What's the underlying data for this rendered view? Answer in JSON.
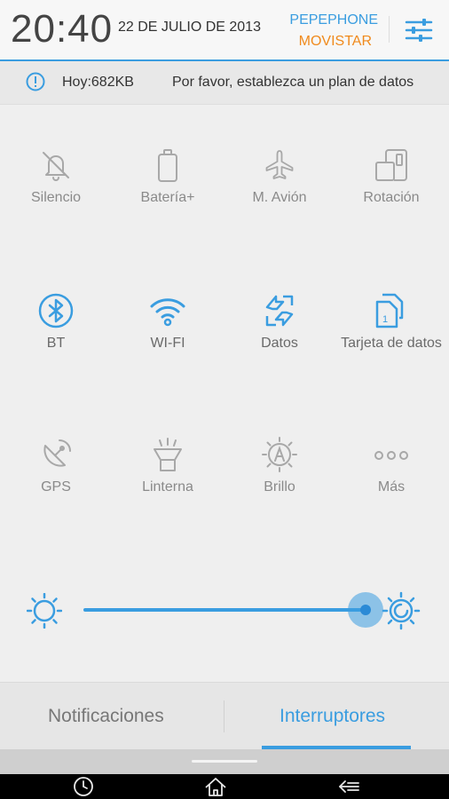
{
  "status": {
    "time": "20:40",
    "date": "22 DE JULIO DE 2013",
    "carrier_primary": "PEPEPHONE",
    "carrier_secondary": "MOVISTAR"
  },
  "data_usage": {
    "today": "Hoy:682KB",
    "message": "Por favor, establezca un plan de datos"
  },
  "toggles": [
    {
      "label": "Silencio",
      "icon": "bell-off-icon",
      "state": "off"
    },
    {
      "label": "Batería+",
      "icon": "battery-icon",
      "state": "off"
    },
    {
      "label": "M. Avión",
      "icon": "airplane-icon",
      "state": "off"
    },
    {
      "label": "Rotación",
      "icon": "rotation-icon",
      "state": "off"
    },
    {
      "label": "BT",
      "icon": "bluetooth-icon",
      "state": "on"
    },
    {
      "label": "WI-FI",
      "icon": "wifi-icon",
      "state": "on"
    },
    {
      "label": "Datos",
      "icon": "data-transfer-icon",
      "state": "on"
    },
    {
      "label": "Tarjeta de datos",
      "icon": "sim-card-icon",
      "state": "on"
    },
    {
      "label": "GPS",
      "icon": "gps-icon",
      "state": "off"
    },
    {
      "label": "Linterna",
      "icon": "flashlight-icon",
      "state": "off"
    },
    {
      "label": "Brillo",
      "icon": "brightness-auto-icon",
      "state": "off"
    },
    {
      "label": "Más",
      "icon": "more-icon",
      "state": "off"
    }
  ],
  "brightness": {
    "value": 0.99
  },
  "tabs": [
    {
      "label": "Notificaciones",
      "active": false
    },
    {
      "label": "Interruptores",
      "active": true
    }
  ],
  "colors": {
    "accent": "#3a9de0",
    "secondary_carrier": "#f08a1c",
    "inactive_icon": "#a8a8a8"
  }
}
